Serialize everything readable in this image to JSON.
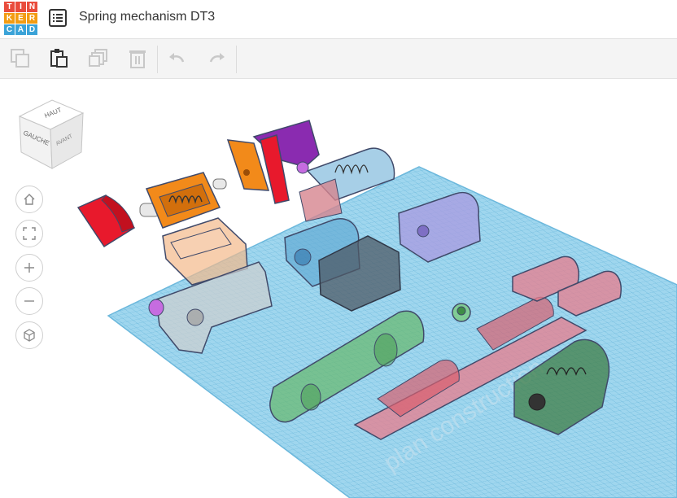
{
  "app": {
    "logo_letters": [
      "T",
      "I",
      "N",
      "K",
      "E",
      "R",
      "C",
      "A",
      "D"
    ],
    "logo_colors": [
      "#e94c3c",
      "#e94c3c",
      "#e94c3c",
      "#f39c12",
      "#f39c12",
      "#f39c12",
      "#3ba3d8",
      "#3ba3d8",
      "#3ba3d8"
    ],
    "title": "Spring mechanism DT3"
  },
  "toolbar": {
    "icons": [
      "copy-icon",
      "paste-icon",
      "duplicate-icon",
      "delete-icon",
      "undo-icon",
      "redo-icon"
    ]
  },
  "viewcube": {
    "top": "HAUT",
    "left": "GAUCHE",
    "front": "AVANT"
  },
  "nav": {
    "icons": [
      "home-icon",
      "fit-view-icon",
      "zoom-in-icon",
      "zoom-out-icon",
      "perspective-icon"
    ]
  },
  "workplane": {
    "label": "plan construction",
    "color": "#7fc8e8"
  },
  "colors": {
    "red": "#e8192c",
    "orange": "#f28a1a",
    "purple": "#8a2bb0",
    "accent_blue": "#3ba3d8"
  }
}
